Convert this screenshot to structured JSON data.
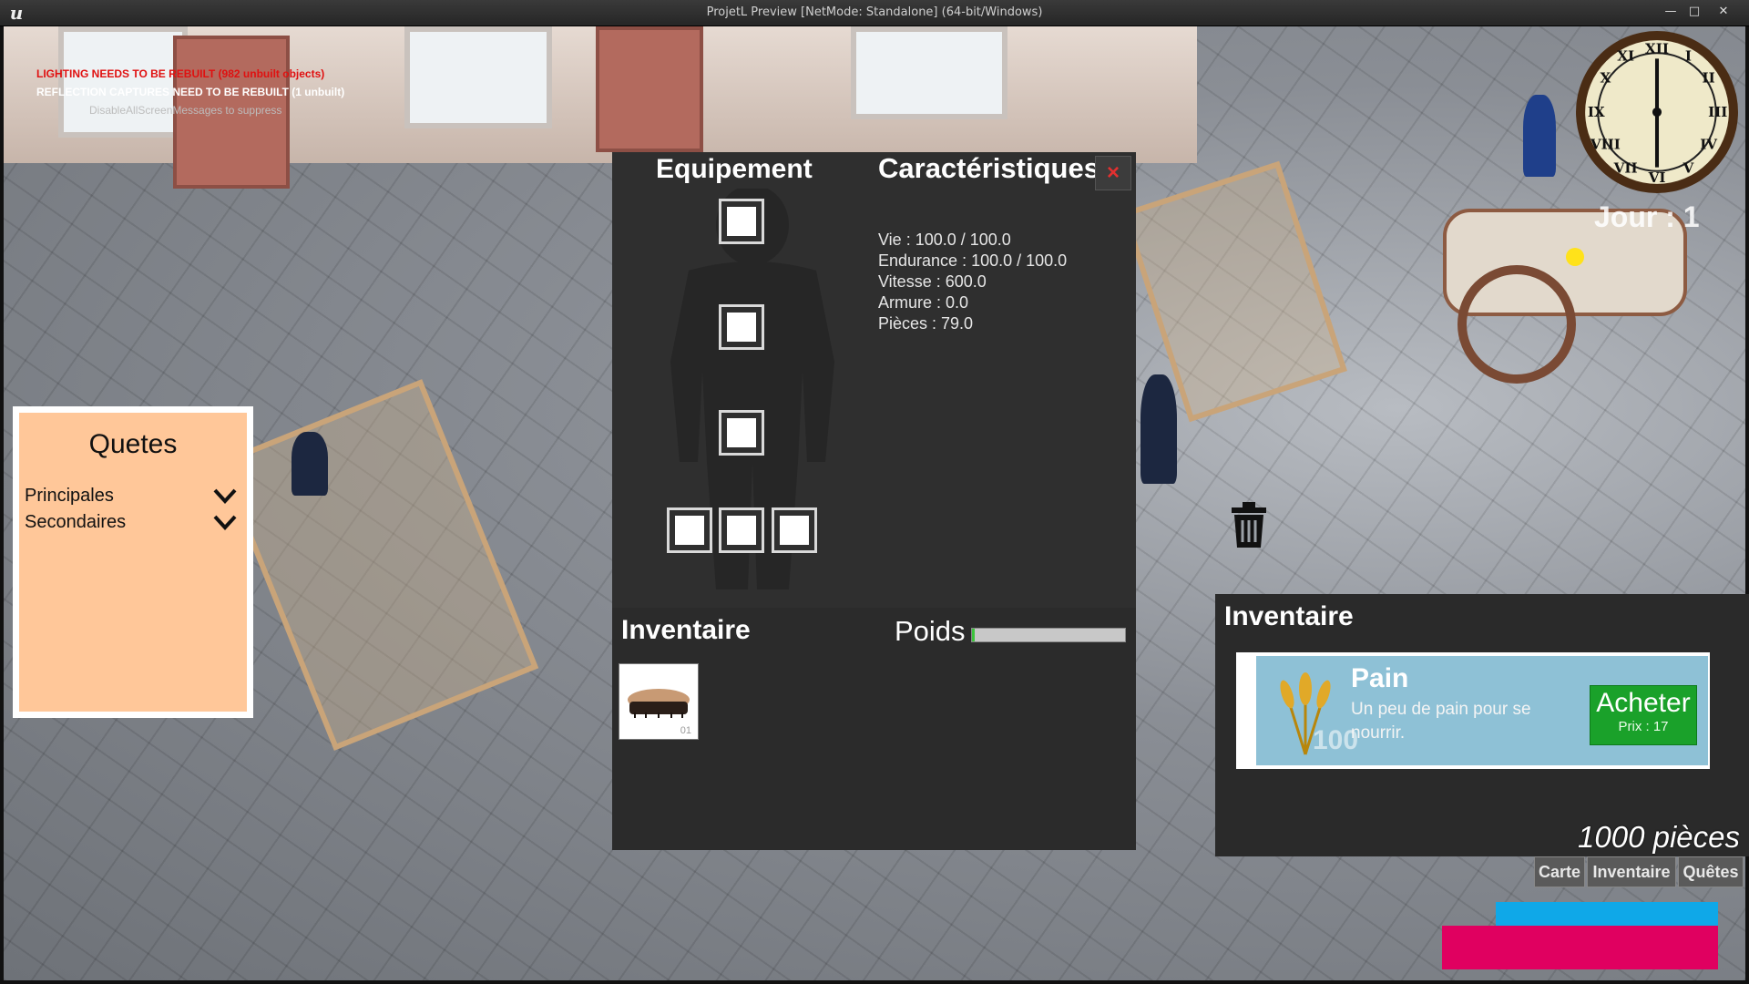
{
  "window": {
    "title": "ProjetL Preview [NetMode: Standalone]  (64-bit/Windows)",
    "minimize_icon": "minimize-icon",
    "maximize_icon": "maximize-icon",
    "close_icon": "close-icon"
  },
  "debug_messages": [
    {
      "text": "LIGHTING NEEDS TO BE REBUILT (982 unbuilt objects)",
      "color": "#e01010"
    },
    {
      "text": "REFLECTION CAPTURES NEED TO BE REBUILT (1 unbuilt)",
      "color": "#ffffff"
    },
    {
      "text": "DisableAllScreenMessages to suppress",
      "color": "#bdbdbd"
    }
  ],
  "quests": {
    "title": "Quetes",
    "categories": [
      {
        "label": "Principales",
        "icon": "chevron-down-icon"
      },
      {
        "label": "Secondaires",
        "icon": "chevron-down-icon"
      }
    ],
    "bg_color": "#ffc799"
  },
  "equipment": {
    "title": "Equipement",
    "slots": [
      "head",
      "torso",
      "legs",
      "accessory-1",
      "accessory-2",
      "accessory-3"
    ]
  },
  "characteristics": {
    "title": "Caractéristiques",
    "close_label": "×",
    "stats": [
      "Vie : 100.0 / 100.0",
      "Endurance : 100.0 / 100.0",
      "Vitesse : 600.0",
      "Armure : 0.0",
      "Pièces : 79.0"
    ]
  },
  "player_inventory": {
    "title": "Inventaire",
    "weight_label": "Poids",
    "weight_fraction": 0.02,
    "items": [
      {
        "icon": "brush-icon",
        "quantity": "01"
      }
    ]
  },
  "shop": {
    "title": "Inventaire",
    "item": {
      "name": "Pain",
      "description": "Un peu de pain pour se nourrir.",
      "stock": "100",
      "icon": "wheat-icon",
      "buy_label": "Acheter",
      "price_label": "Prix : 17"
    },
    "coins": "1000 pièces"
  },
  "nav": {
    "map": "Carte",
    "inventory": "Inventaire",
    "quests": "Quêtes"
  },
  "hud": {
    "day": "Jour : 1",
    "health_color": "#e00060",
    "stamina_color": "#0fa8e8"
  },
  "colors": {
    "buy_button": "#1aa12a",
    "close_x": "#e23030",
    "panel_dark": "#2f2f2f"
  }
}
